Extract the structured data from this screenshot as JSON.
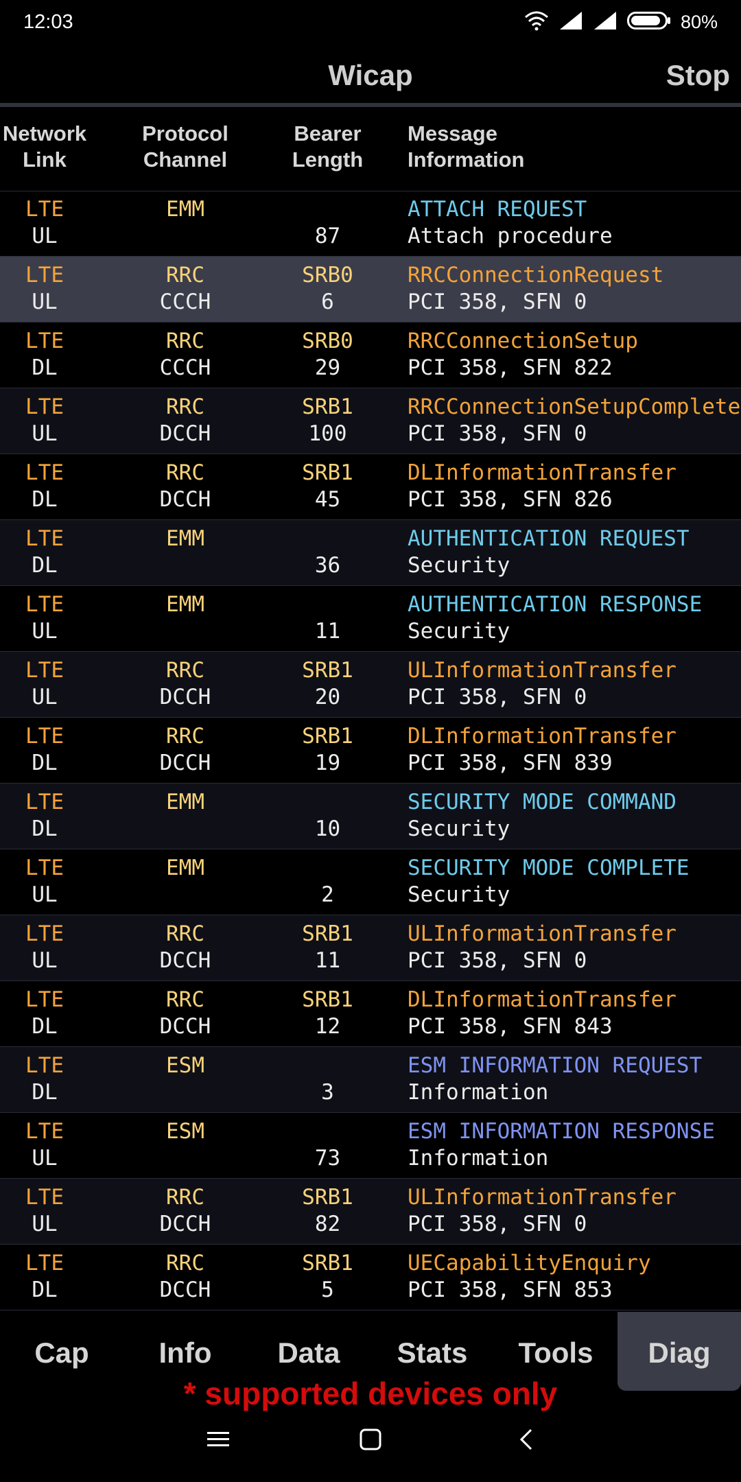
{
  "status_bar": {
    "time": "12:03",
    "battery": "80%"
  },
  "header": {
    "title": "Wicap",
    "stop_label": "Stop"
  },
  "columns": {
    "network": "Network",
    "link": "Link",
    "protocol": "Protocol",
    "channel": "Channel",
    "bearer": "Bearer",
    "length": "Length",
    "message": "Message",
    "information": "Information"
  },
  "rows": [
    {
      "network": "LTE",
      "link": "UL",
      "protocol": "EMM",
      "channel": "",
      "bearer": "",
      "length": "87",
      "message": "ATTACH REQUEST",
      "info": "Attach procedure",
      "msg_color": "cyan"
    },
    {
      "network": "LTE",
      "link": "UL",
      "protocol": "RRC",
      "channel": "CCCH",
      "bearer": "SRB0",
      "length": "6",
      "message": "RRCConnectionRequest",
      "info": "PCI 358, SFN 0",
      "msg_color": "orange"
    },
    {
      "network": "LTE",
      "link": "DL",
      "protocol": "RRC",
      "channel": "CCCH",
      "bearer": "SRB0",
      "length": "29",
      "message": "RRCConnectionSetup",
      "info": "PCI 358, SFN 822",
      "msg_color": "orange"
    },
    {
      "network": "LTE",
      "link": "UL",
      "protocol": "RRC",
      "channel": "DCCH",
      "bearer": "SRB1",
      "length": "100",
      "message": "RRCConnectionSetupComplete",
      "info": "PCI 358, SFN 0",
      "msg_color": "orange"
    },
    {
      "network": "LTE",
      "link": "DL",
      "protocol": "RRC",
      "channel": "DCCH",
      "bearer": "SRB1",
      "length": "45",
      "message": "DLInformationTransfer",
      "info": "PCI 358, SFN 826",
      "msg_color": "orange"
    },
    {
      "network": "LTE",
      "link": "DL",
      "protocol": "EMM",
      "channel": "",
      "bearer": "",
      "length": "36",
      "message": "AUTHENTICATION REQUEST",
      "info": "Security",
      "msg_color": "cyan"
    },
    {
      "network": "LTE",
      "link": "UL",
      "protocol": "EMM",
      "channel": "",
      "bearer": "",
      "length": "11",
      "message": "AUTHENTICATION RESPONSE",
      "info": "Security",
      "msg_color": "cyan"
    },
    {
      "network": "LTE",
      "link": "UL",
      "protocol": "RRC",
      "channel": "DCCH",
      "bearer": "SRB1",
      "length": "20",
      "message": "ULInformationTransfer",
      "info": "PCI 358, SFN 0",
      "msg_color": "orange"
    },
    {
      "network": "LTE",
      "link": "DL",
      "protocol": "RRC",
      "channel": "DCCH",
      "bearer": "SRB1",
      "length": "19",
      "message": "DLInformationTransfer",
      "info": "PCI 358, SFN 839",
      "msg_color": "orange"
    },
    {
      "network": "LTE",
      "link": "DL",
      "protocol": "EMM",
      "channel": "",
      "bearer": "",
      "length": "10",
      "message": "SECURITY MODE COMMAND",
      "info": "Security",
      "msg_color": "cyan"
    },
    {
      "network": "LTE",
      "link": "UL",
      "protocol": "EMM",
      "channel": "",
      "bearer": "",
      "length": "2",
      "message": "SECURITY MODE COMPLETE",
      "info": "Security",
      "msg_color": "cyan"
    },
    {
      "network": "LTE",
      "link": "UL",
      "protocol": "RRC",
      "channel": "DCCH",
      "bearer": "SRB1",
      "length": "11",
      "message": "ULInformationTransfer",
      "info": "PCI 358, SFN 0",
      "msg_color": "orange"
    },
    {
      "network": "LTE",
      "link": "DL",
      "protocol": "RRC",
      "channel": "DCCH",
      "bearer": "SRB1",
      "length": "12",
      "message": "DLInformationTransfer",
      "info": "PCI 358, SFN 843",
      "msg_color": "orange"
    },
    {
      "network": "LTE",
      "link": "DL",
      "protocol": "ESM",
      "channel": "",
      "bearer": "",
      "length": "3",
      "message": "ESM INFORMATION REQUEST",
      "info": "Information",
      "msg_color": "blue"
    },
    {
      "network": "LTE",
      "link": "UL",
      "protocol": "ESM",
      "channel": "",
      "bearer": "",
      "length": "73",
      "message": "ESM INFORMATION RESPONSE",
      "info": "Information",
      "msg_color": "blue"
    },
    {
      "network": "LTE",
      "link": "UL",
      "protocol": "RRC",
      "channel": "DCCH",
      "bearer": "SRB1",
      "length": "82",
      "message": "ULInformationTransfer",
      "info": "PCI 358, SFN 0",
      "msg_color": "orange"
    },
    {
      "network": "LTE",
      "link": "DL",
      "protocol": "RRC",
      "channel": "DCCH",
      "bearer": "SRB1",
      "length": "5",
      "message": "UECapabilityEnquiry",
      "info": "PCI 358, SFN 853",
      "msg_color": "orange"
    }
  ],
  "selected_row": 1,
  "bottom_tabs": [
    "Cap",
    "Info",
    "Data",
    "Stats",
    "Tools",
    "Diag"
  ],
  "active_tab": "Diag",
  "note": "* supported devices only",
  "colors": {
    "network": "#f3a33a",
    "protocol": "#f8d27a",
    "message_rrc": "#f3a33a",
    "message_emm": "#6ecbeb",
    "message_esm": "#7f93f2",
    "note": "#d40c0c"
  }
}
